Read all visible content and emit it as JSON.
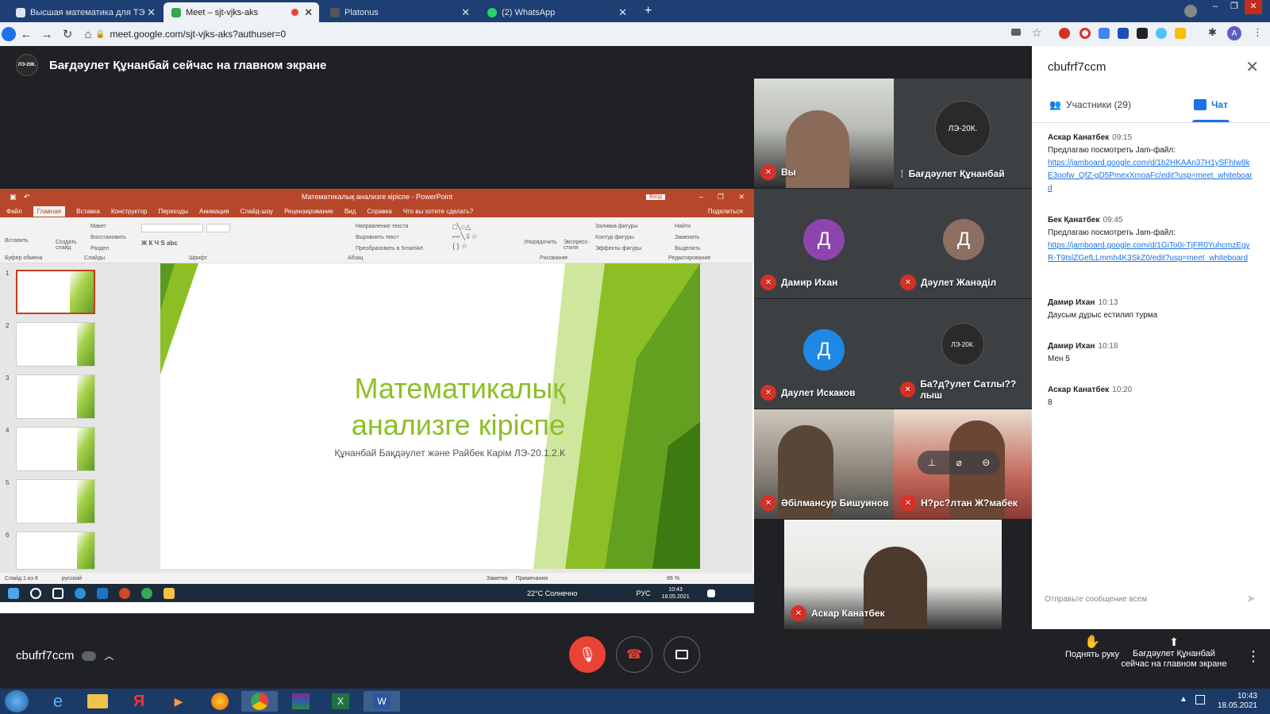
{
  "browser": {
    "tabs": [
      {
        "title": "Высшая математика для ТЭ"
      },
      {
        "title": "Meet – sjt-vjks-aks"
      },
      {
        "title": "Platonus"
      },
      {
        "title": "(2) WhatsApp"
      }
    ],
    "url": "meet.google.com/sjt-vjks-aks?authuser=0",
    "profile_initial": "A"
  },
  "meet": {
    "presenting_banner": "Бағдәулет Құнанбай сейчас на главном экране",
    "presenter_logo_text": "ЛЭ-20К.",
    "meeting_code": "cbufrf7ccm",
    "participants": [
      {
        "name": "Вы",
        "type": "camera",
        "muted": true
      },
      {
        "name": "Бағдәулет Құнанбай",
        "type": "logo",
        "muted": false,
        "logo_text": "ЛЭ-20К."
      },
      {
        "name": "Дамир Ихан",
        "type": "avatar",
        "initial": "Д",
        "muted": true,
        "color": "#8e44ad"
      },
      {
        "name": "Дәулет Жанәділ",
        "type": "avatar",
        "initial": "Д",
        "muted": true,
        "color": "#8d6e63"
      },
      {
        "name": "Даулет Искаков",
        "type": "avatar",
        "initial": "Д",
        "muted": true,
        "color": "#1e88e5"
      },
      {
        "name": "Ба?д?улет Сатлы??лыш",
        "type": "logo",
        "muted": true,
        "logo_text": "ЛЭ-20К."
      },
      {
        "name": "Әбілмансур Бишуинов",
        "type": "camera",
        "muted": true
      },
      {
        "name": "Н?рс?лтан Ж?мабек",
        "type": "camera",
        "muted": true
      },
      {
        "name": "Аскар Канатбек",
        "type": "camera",
        "muted": true
      }
    ]
  },
  "ppt": {
    "window_title": "Математикалық анализге кіріспе - PowerPoint",
    "signin": "Вход",
    "share": "Поделиться",
    "menu": [
      "Файл",
      "Главная",
      "Вставка",
      "Конструктор",
      "Переходы",
      "Анимация",
      "Слайд-шоу",
      "Рецензирование",
      "Вид",
      "Справка",
      "Что вы хотите сделать?"
    ],
    "ribbon_groups": [
      "Буфер обмена",
      "Слайды",
      "Шрифт",
      "Абзац",
      "Рисование",
      "Редактирование"
    ],
    "ribbon_items": [
      "Вставить",
      "Создать слайд",
      "Макет",
      "Восстановить",
      "Раздел",
      "Найти",
      "Заменить",
      "Выделить",
      "Упорядочить",
      "Экспресс-стили",
      "Заливка фигуры",
      "Контур фигуры",
      "Эффекты фигуры",
      "Направление текста",
      "Выровнять текст",
      "Преобразовать в SmartArt"
    ],
    "slide_numbers": [
      "1",
      "2",
      "3",
      "4",
      "5",
      "6"
    ],
    "slide_title_line1": "Математикалық",
    "slide_title_line2": "анализге кіріспе",
    "slide_subtitle": "Құнанбай Бақдәулет және Райбек Карім ЛЭ-20.1.2.К",
    "status_slide": "Слайд 1 из 8",
    "status_lang": "русский",
    "status_notes": "Заметки",
    "status_comments": "Примечания",
    "zoom": "86 %",
    "weather": "22°C Солнечно",
    "lang": "РУС",
    "time": "10:43",
    "date": "18.05.2021"
  },
  "panel": {
    "title": "cbufrf7ccm",
    "tab_people": "Участники (29)",
    "tab_chat": "Чат",
    "messages": [
      {
        "author": "Аскар Канатбек",
        "time": "09:15",
        "text": "Предлагаю посмотреть Jam-файл:",
        "link": "https://jamboard.google.com/d/1b2HKAAn37H1ySFhIw8kE3oofw_QfZ-gD5PmexXmoaFc/edit?usp=meet_whiteboard"
      },
      {
        "author": "Бек Қанатбек",
        "time": "09:45",
        "text": "Предлагаю посмотреть Jam-файл:",
        "link": "https://jamboard.google.com/d/1GiTo0i-TjFR0YuhcmzEgyR-T9tslZGefLLmmh4K3SkZ0/edit?usp=meet_whiteboard"
      },
      {
        "author": "Дамир Ихан",
        "time": "10:13",
        "text": "Даусым дұрыс естилип турма",
        "link": ""
      },
      {
        "author": "Дамир Ихан",
        "time": "10:18",
        "text": "Мен 5",
        "link": ""
      },
      {
        "author": "Аскар Канатбек",
        "time": "10:20",
        "text": "8",
        "link": ""
      }
    ],
    "input_placeholder": "Отправьте сообщение всем"
  },
  "controls": {
    "raise_hand": "Поднять руку",
    "presenting_line1": "Бағдәулет Құнанбай",
    "presenting_line2": "сейчас на главном экране"
  },
  "taskbar": {
    "time": "10:43",
    "date": "18.05.2021"
  },
  "colors": {
    "meet_bg": "#202124",
    "ppt_accent": "#b7472a",
    "slide_green": "#8cbf26",
    "mic_off": "#d93025",
    "link": "#1a73e8"
  }
}
